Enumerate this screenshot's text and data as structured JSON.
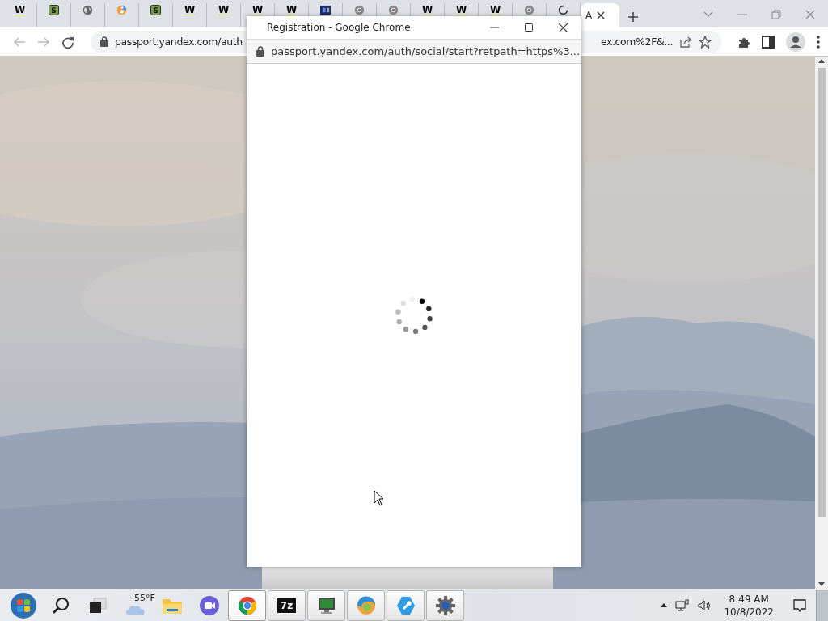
{
  "browser": {
    "tabs": [
      {
        "kind": "letter-plain",
        "glyph": "W",
        "selected": false
      },
      {
        "kind": "letter-boxed",
        "glyph": "S",
        "selected": false
      },
      {
        "kind": "globe",
        "selected": false
      },
      {
        "kind": "person",
        "selected": false
      },
      {
        "kind": "letter-boxed",
        "glyph": "S",
        "selected": false
      },
      {
        "kind": "letter-plain",
        "glyph": "W",
        "selected": false
      },
      {
        "kind": "letter-plain",
        "glyph": "W",
        "selected": false
      },
      {
        "kind": "letter-plain",
        "glyph": "W",
        "selected": false
      },
      {
        "kind": "letter-plain",
        "glyph": "W",
        "selected": false
      },
      {
        "kind": "square",
        "selected": false
      },
      {
        "kind": "chrome",
        "selected": false
      },
      {
        "kind": "chrome",
        "selected": false
      },
      {
        "kind": "letter-plain",
        "glyph": "W",
        "selected": false
      },
      {
        "kind": "letter-plain",
        "glyph": "W",
        "selected": false
      },
      {
        "kind": "letter-plain",
        "glyph": "W",
        "selected": false
      },
      {
        "kind": "chrome",
        "selected": false
      },
      {
        "kind": "loading",
        "selected": false
      },
      {
        "kind": "blank",
        "title": "A",
        "selected": true
      }
    ],
    "toolbar": {
      "url_start": "passport.yandex.com/auth",
      "url_end": "ex.com%2F&..."
    }
  },
  "popup": {
    "title": "Registration - Google Chrome",
    "url": "passport.yandex.com/auth/social/start?retpath=https%3..."
  },
  "taskbar": {
    "weather": "55°F",
    "apps": [
      {
        "kind": "explorer",
        "open": false,
        "selected": false
      },
      {
        "kind": "meet",
        "open": false,
        "selected": false
      },
      {
        "kind": "chrome",
        "open": true,
        "selected": true
      },
      {
        "kind": "glyph",
        "glyph": "7z",
        "open": true,
        "selected": false
      },
      {
        "kind": "monitor",
        "open": true,
        "selected": false
      },
      {
        "kind": "edge",
        "open": true,
        "selected": false
      },
      {
        "kind": "tool",
        "open": true,
        "selected": false
      },
      {
        "kind": "settings",
        "open": true,
        "selected": false
      }
    ],
    "time": "8:49 AM",
    "date": "10/8/2022"
  }
}
